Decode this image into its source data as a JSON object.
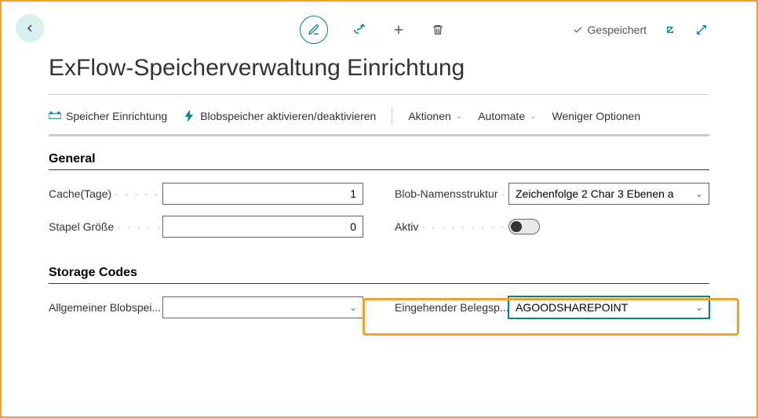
{
  "toolbar": {
    "saved_label": "Gespeichert"
  },
  "page": {
    "title": "ExFlow-Speicherverwaltung Einrichtung"
  },
  "actions": {
    "storage_setup": "Speicher Einrichtung",
    "blob_toggle": "Blobspeicher aktivieren/deaktivieren",
    "aktionen": "Aktionen",
    "automate": "Automate",
    "fewer_options": "Weniger Optionen"
  },
  "sections": {
    "general": "General",
    "storage_codes": "Storage Codes"
  },
  "fields": {
    "cache_label": "Cache(Tage)",
    "cache_value": "1",
    "batch_label": "Stapel Größe",
    "batch_value": "0",
    "blob_name_label": "Blob-Namensstruktur",
    "blob_name_value": "Zeichenfolge 2 Char 3 Ebenen a",
    "active_label": "Aktiv",
    "general_blob_label": "Allgemeiner Blobspei...",
    "general_blob_value": "",
    "incoming_doc_label": "Eingehender Belegsp...",
    "incoming_doc_value": "AGOODSHAREPOINT"
  }
}
